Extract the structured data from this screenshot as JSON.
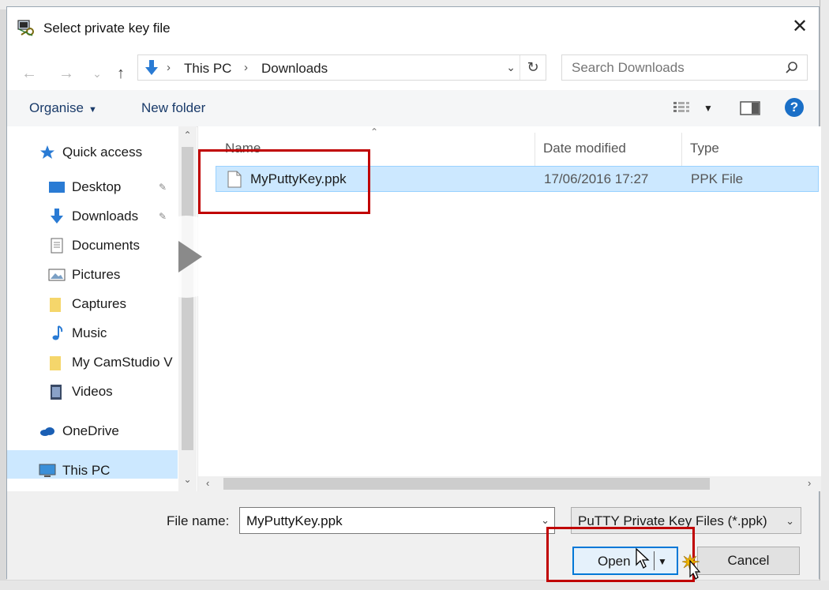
{
  "window": {
    "title": "Select private key file",
    "close_glyph": "✕"
  },
  "address_bar": {
    "crumbs": [
      "This PC",
      "Downloads"
    ],
    "separator": "›",
    "dropdown_glyph": "⌄",
    "refresh_glyph": "↻"
  },
  "nav_buttons": {
    "back": "←",
    "forward": "→",
    "recent": "⌄",
    "up": "↑"
  },
  "search": {
    "placeholder": "Search Downloads"
  },
  "toolbar": {
    "organise": "Organise",
    "organise_caret": "▼",
    "new_folder": "New folder",
    "view_caret": "▼",
    "help_glyph": "?"
  },
  "nav_pane": {
    "items": [
      {
        "label": "Quick access",
        "icon": "star-icon"
      },
      {
        "label": "Desktop",
        "icon": "desktop-icon",
        "pinned": true
      },
      {
        "label": "Downloads",
        "icon": "download-arrow-icon",
        "pinned": true
      },
      {
        "label": "Documents",
        "icon": "document-icon",
        "pinned": true
      },
      {
        "label": "Pictures",
        "icon": "pictures-icon",
        "pinned": true
      },
      {
        "label": "Captures",
        "icon": "folder-icon"
      },
      {
        "label": "Music",
        "icon": "music-icon"
      },
      {
        "label": "My CamStudio V",
        "icon": "folder-icon"
      },
      {
        "label": "Videos",
        "icon": "video-icon"
      },
      {
        "label": "OneDrive",
        "icon": "cloud-icon"
      },
      {
        "label": "This PC",
        "icon": "computer-icon",
        "selected": true
      }
    ],
    "pin_glyph": "📌",
    "scroll_up": "⌃",
    "scroll_down": "⌄"
  },
  "file_list": {
    "columns": [
      "Name",
      "Date modified",
      "Type"
    ],
    "sort_glyph": "⌃",
    "rows": [
      {
        "name": "MyPuttyKey.ppk",
        "date": "17/06/2016 17:27",
        "type": "PPK File",
        "selected": true
      }
    ],
    "hscroll_left": "‹",
    "hscroll_right": "›"
  },
  "bottom": {
    "file_name_label": "File name:",
    "file_name_value": "MyPuttyKey.ppk",
    "file_name_dropdown": "⌄",
    "filter_value": "PuTTY Private Key Files (*.ppk)",
    "filter_dropdown": "⌄",
    "open_label": "Open",
    "open_caret": "▼",
    "cancel_label": "Cancel"
  },
  "colors": {
    "highlight_box": "#c00000",
    "selection_bg": "#cce8ff",
    "accent": "#0078d7"
  }
}
